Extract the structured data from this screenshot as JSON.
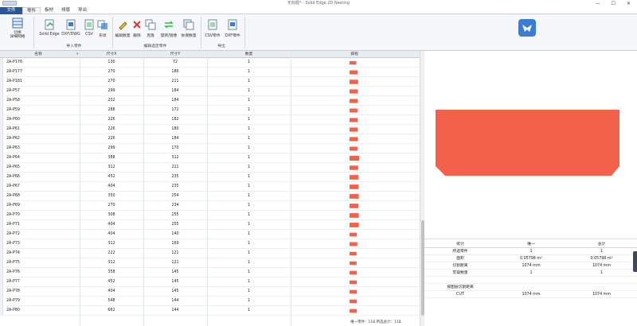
{
  "window": {
    "title": "无标题* - Solid Edge 2D Nesting",
    "controls": [
      "—",
      "☐",
      "✕"
    ]
  },
  "menu": {
    "file": "文件",
    "tabs": [
      "零件",
      "板材",
      "排版",
      "导出"
    ],
    "active": 0
  },
  "ribbon": {
    "switch_label": "切换\n详细网格",
    "import_buttons": [
      "Solid Edge",
      "DXF/DWG",
      "CSV",
      "形状"
    ],
    "import_group": "导入零件",
    "edit_buttons": [
      "编辑数量",
      "删除",
      "克隆",
      "旋转/镜像",
      "依保数量"
    ],
    "edit_group": "编辑选定零件",
    "export_buttons": [
      "CSV零件",
      "DXF零件"
    ],
    "export_group": "导出"
  },
  "grid": {
    "columns": [
      "名称",
      "尺寸X",
      "尺寸Y",
      "数量",
      "排程"
    ],
    "rows": [
      {
        "name": "2A-P176",
        "x": "130",
        "y": "72",
        "qty": "1",
        "thumb": 0.55
      },
      {
        "name": "2A-P177",
        "x": "270",
        "y": "186",
        "qty": "1",
        "thumb": 0.75
      },
      {
        "name": "2A-P181",
        "x": "270",
        "y": "211",
        "qty": "1",
        "thumb": 0.85
      },
      {
        "name": "2A-P57",
        "x": "299",
        "y": "184",
        "qty": "1",
        "thumb": 0.8
      },
      {
        "name": "2A-P58",
        "x": "202",
        "y": "184",
        "qty": "1",
        "thumb": 0.78
      },
      {
        "name": "2A-P59",
        "x": "288",
        "y": "172",
        "qty": "1",
        "thumb": 0.74
      },
      {
        "name": "2A-P60",
        "x": "226",
        "y": "182",
        "qty": "1",
        "thumb": 0.78
      },
      {
        "name": "2A-P61",
        "x": "226",
        "y": "180",
        "qty": "1",
        "thumb": 0.78
      },
      {
        "name": "2A-P62",
        "x": "226",
        "y": "184",
        "qty": "1",
        "thumb": 0.8
      },
      {
        "name": "2A-P63",
        "x": "299",
        "y": "170",
        "qty": "1",
        "thumb": 0.74
      },
      {
        "name": "2A-P64",
        "x": "388",
        "y": "312",
        "qty": "1",
        "thumb": 1.0
      },
      {
        "name": "2A-P65",
        "x": "312",
        "y": "211",
        "qty": "1",
        "thumb": 0.85
      },
      {
        "name": "2A-P66",
        "x": "452",
        "y": "235",
        "qty": "1",
        "thumb": 0.92
      },
      {
        "name": "2A-P67",
        "x": "404",
        "y": "235",
        "qty": "1",
        "thumb": 0.92
      },
      {
        "name": "2A-P68",
        "x": "350",
        "y": "254",
        "qty": "1",
        "thumb": 0.95
      },
      {
        "name": "2A-P69",
        "x": "270",
        "y": "234",
        "qty": "1",
        "thumb": 0.9
      },
      {
        "name": "2A-P70",
        "x": "308",
        "y": "255",
        "qty": "1",
        "thumb": 0.95
      },
      {
        "name": "2A-P71",
        "x": "404",
        "y": "255",
        "qty": "1",
        "thumb": 0.95
      },
      {
        "name": "2A-P72",
        "x": "404",
        "y": "140",
        "qty": "1",
        "thumb": 0.65
      },
      {
        "name": "2A-P73",
        "x": "312",
        "y": "169",
        "qty": "1",
        "thumb": 0.72
      },
      {
        "name": "2A-P74",
        "x": "222",
        "y": "121",
        "qty": "1",
        "thumb": 0.6
      },
      {
        "name": "2A-P75",
        "x": "312",
        "y": "121",
        "qty": "1",
        "thumb": 0.6
      },
      {
        "name": "2A-P76",
        "x": "358",
        "y": "145",
        "qty": "1",
        "thumb": 0.65
      },
      {
        "name": "2A-P77",
        "x": "452",
        "y": "145",
        "qty": "1",
        "thumb": 0.65
      },
      {
        "name": "2A-P78",
        "x": "404",
        "y": "145",
        "qty": "1",
        "thumb": 0.65
      },
      {
        "name": "2A-P79",
        "x": "548",
        "y": "144",
        "qty": "1",
        "thumb": 0.65
      },
      {
        "name": "2A-P80",
        "x": "662",
        "y": "144",
        "qty": "1",
        "thumb": 0.65
      }
    ]
  },
  "stats": {
    "headers": [
      "统计",
      "唯一",
      "总计"
    ],
    "rows": [
      [
        "所选零件",
        "1",
        "1"
      ],
      [
        "面积",
        "0.05798 m²",
        "0.05798 m²"
      ],
      [
        "切割距离",
        "1074 mm",
        "1074 mm"
      ],
      [
        "贯穿数量",
        "1",
        "1"
      ],
      [
        "",
        "",
        ""
      ],
      [
        "按图层切割距离",
        "",
        ""
      ],
      [
        "CUT",
        "1074 mm",
        "1074 mm"
      ]
    ]
  },
  "status": {
    "text": "唯一零件：118   所选总计：118"
  },
  "colors": {
    "part": "#f4614a",
    "accent": "#2b579a"
  }
}
